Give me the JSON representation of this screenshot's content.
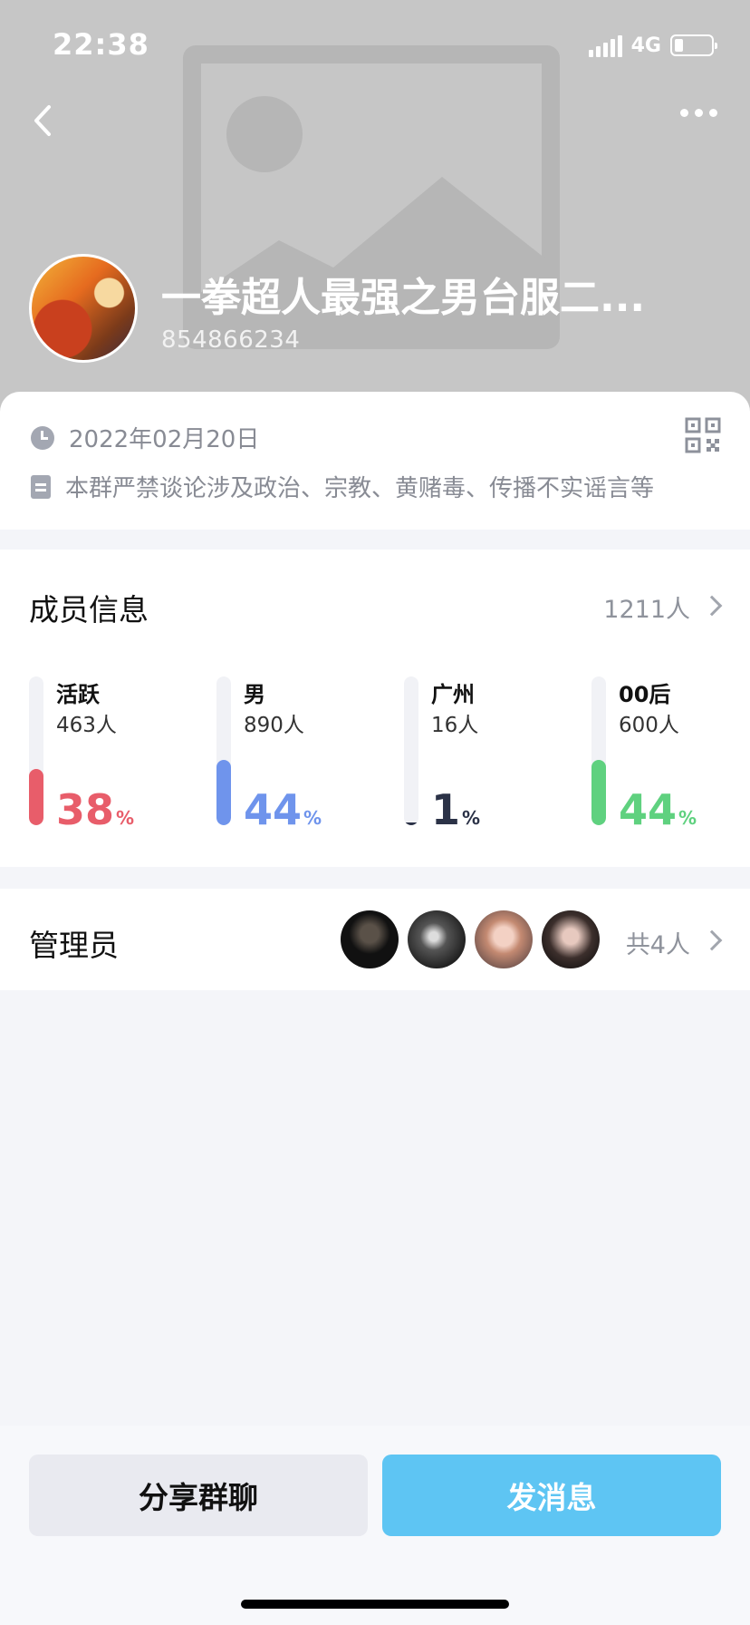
{
  "status_bar": {
    "time": "22:38",
    "network": "4G"
  },
  "group": {
    "name": "一拳超人最强之男台服二...",
    "id": "854866234",
    "created_date": "2022年02月20日",
    "notice": "本群严禁谈论涉及政治、宗教、黄赌毒、传播不实谣言等"
  },
  "members": {
    "title": "成员信息",
    "count": "1211人",
    "stats": [
      {
        "label": "活跃",
        "sub": "463人",
        "value": "38",
        "unit": "%",
        "fill": 0.38,
        "color": "#e85d6a"
      },
      {
        "label": "男",
        "sub": "890人",
        "value": "44",
        "unit": "%",
        "fill": 0.44,
        "color": "#6f94ec"
      },
      {
        "label": "广州",
        "sub": "16人",
        "value": "1",
        "unit": "%",
        "fill": 0.01,
        "color": "#2b3247"
      },
      {
        "label": "00后",
        "sub": "600人",
        "value": "44",
        "unit": "%",
        "fill": 0.44,
        "color": "#5fd17f"
      }
    ]
  },
  "admins": {
    "title": "管理员",
    "total": "共4人"
  },
  "buttons": {
    "share": "分享群聊",
    "send": "发消息"
  },
  "icons": [
    "back-icon",
    "more-icon",
    "clock-icon",
    "document-icon",
    "qr-code-icon",
    "chevron-right-icon"
  ]
}
